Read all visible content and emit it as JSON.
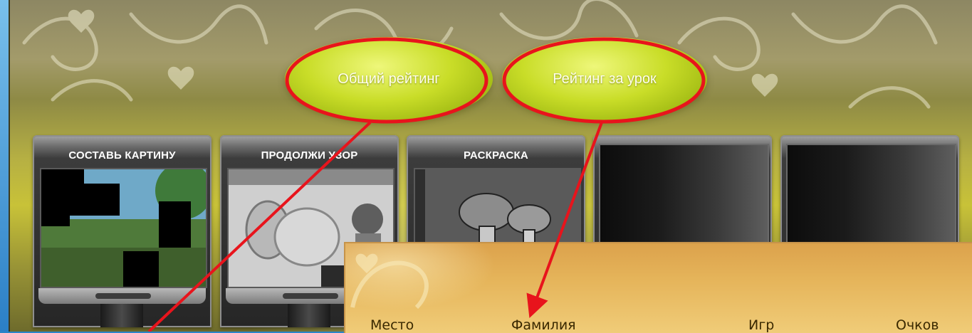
{
  "rating_buttons": {
    "overall_label": "Общий рейтинг",
    "lesson_label": "Рейтинг за урок"
  },
  "games": [
    {
      "title": "СОСТАВЬ КАРТИНУ"
    },
    {
      "title": "ПРОДОЛЖИ УЗОР"
    },
    {
      "title": "РАСКРАСКА"
    },
    {
      "title": ""
    },
    {
      "title": ""
    }
  ],
  "rating_table": {
    "columns": [
      "Место",
      "Фамилия",
      "Игр",
      "Очков"
    ]
  },
  "colors": {
    "annotation_red": "#e8141c",
    "pill_green": "#c9dd28",
    "panel_orange": "#e5b45a"
  }
}
